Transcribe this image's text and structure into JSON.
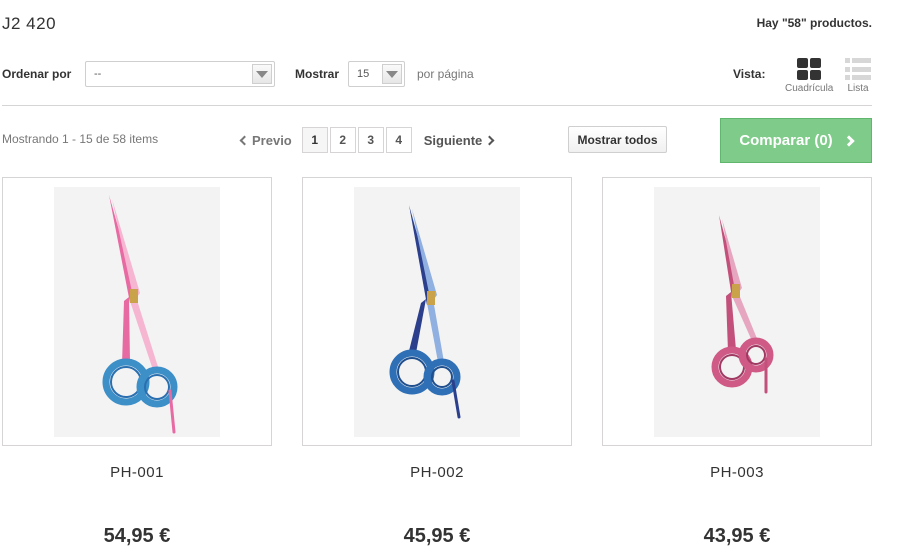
{
  "header": {
    "title": "J2 420",
    "product_count": "Hay \"58\" productos."
  },
  "toolbar": {
    "sort_label": "Ordenar por",
    "sort_value": "--",
    "show_label": "Mostrar",
    "show_value": "15",
    "per_page_label": "por página",
    "view_label": "Vista:",
    "view_grid_label": "Cuadrícula",
    "view_list_label": "Lista"
  },
  "pagination": {
    "showing_text": "Mostrando 1 - 15 de 58 items",
    "prev_label": "Previo",
    "pages": [
      "1",
      "2",
      "3",
      "4"
    ],
    "current_page": "1",
    "next_label": "Siguiente",
    "show_all_label": "Mostrar todos"
  },
  "compare": {
    "label": "Comparar (0)"
  },
  "products": [
    {
      "name": "PH-001",
      "price": "54,95 €",
      "colors": {
        "blade": "#e86aa3",
        "blade_light": "#f6b6d2",
        "ring": "#3d8fc8",
        "ring_inner": "#2a6fb0"
      }
    },
    {
      "name": "PH-002",
      "price": "45,95 €",
      "colors": {
        "blade": "#2b3f8c",
        "blade_light": "#8fb0e0",
        "ring": "#2f6fb5",
        "ring_inner": "#1f4f8f"
      }
    },
    {
      "name": "PH-003",
      "price": "43,95 €",
      "colors": {
        "blade": "#c2507a",
        "blade_light": "#e7a6bf",
        "ring": "#d05a86",
        "ring_inner": "#a03a63"
      }
    }
  ],
  "colors": {
    "compare_bg": "#7fcb8a",
    "border": "#d6d4d4",
    "text": "#333333"
  }
}
